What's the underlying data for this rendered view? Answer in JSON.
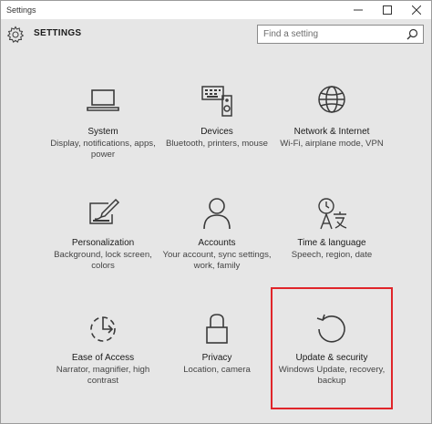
{
  "window": {
    "title": "Settings"
  },
  "header": {
    "title": "SETTINGS"
  },
  "search": {
    "placeholder": "Find a setting"
  },
  "tiles": [
    {
      "label": "System",
      "desc": "Display, notifications, apps, power",
      "icon": "laptop-icon"
    },
    {
      "label": "Devices",
      "desc": "Bluetooth, printers, mouse",
      "icon": "devices-icon"
    },
    {
      "label": "Network & Internet",
      "desc": "Wi-Fi, airplane mode, VPN",
      "icon": "globe-icon"
    },
    {
      "label": "Personalization",
      "desc": "Background, lock screen, colors",
      "icon": "paint-icon"
    },
    {
      "label": "Accounts",
      "desc": "Your account, sync settings, work, family",
      "icon": "person-icon"
    },
    {
      "label": "Time & language",
      "desc": "Speech, region, date",
      "icon": "language-icon"
    },
    {
      "label": "Ease of Access",
      "desc": "Narrator, magnifier, high contrast",
      "icon": "ease-of-access-icon"
    },
    {
      "label": "Privacy",
      "desc": "Location, camera",
      "icon": "lock-icon"
    },
    {
      "label": "Update & security",
      "desc": "Windows Update, recovery, backup",
      "icon": "refresh-icon"
    }
  ],
  "highlight_color": "#e0252a"
}
